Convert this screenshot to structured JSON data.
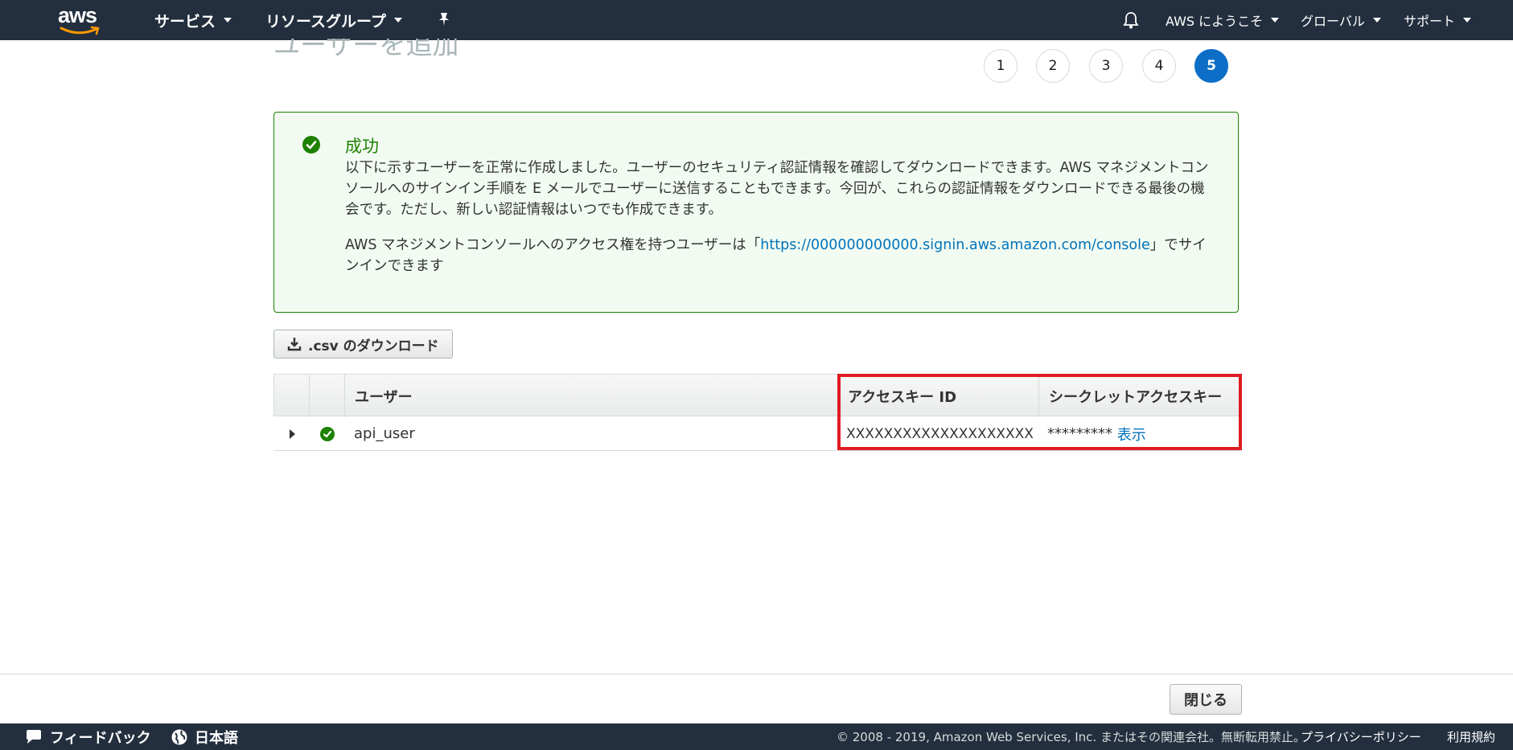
{
  "nav": {
    "logo": "aws",
    "services": "サービス",
    "resource_groups": "リソースグループ",
    "welcome": "AWS にようこそ",
    "region": "グローバル",
    "support": "サポート"
  },
  "wizard": {
    "title": "ユーザーを追加",
    "steps": [
      "1",
      "2",
      "3",
      "4",
      "5"
    ],
    "active_step": "5"
  },
  "success": {
    "title": "成功",
    "message": "以下に示すユーザーを正常に作成しました。ユーザーのセキュリティ認証情報を確認してダウンロードできます。AWS マネジメントコンソールへのサインイン手順を E メールでユーザーに送信することもできます。今回が、これらの認証情報をダウンロードできる最後の機会です。ただし、新しい認証情報はいつでも作成できます。",
    "console_prefix": "AWS マネジメントコンソールへのアクセス権を持つユーザーは「",
    "console_url": "https://000000000000.signin.aws.amazon.com/console",
    "console_suffix": "」でサインインできます"
  },
  "download_button": ".csv のダウンロード",
  "table": {
    "headers": {
      "user": "ユーザー",
      "access_key_id": "アクセスキー ID",
      "secret_access_key": "シークレットアクセスキー"
    },
    "rows": [
      {
        "user": "api_user",
        "access_key_id": "XXXXXXXXXXXXXXXXXXXX",
        "secret_masked": "*********",
        "show_link": "表示"
      }
    ]
  },
  "actions": {
    "close": "閉じる"
  },
  "footer": {
    "feedback": "フィードバック",
    "language": "日本語",
    "copyright": "© 2008 - 2019, Amazon Web Services, Inc. またはその関連会社。無断転用禁止。",
    "privacy": "プライバシーポリシー",
    "terms": "利用規約"
  },
  "colors": {
    "nav_bg": "#232f3e",
    "success_green": "#1d8102",
    "active_step_blue": "#0d6ec7",
    "link_blue": "#0073bb",
    "highlight_red": "#e01b24"
  },
  "icons": [
    "aws-logo",
    "pin-icon",
    "bell-icon",
    "check-circle-icon",
    "download-icon",
    "expand-caret-icon",
    "chat-icon",
    "globe-icon"
  ]
}
